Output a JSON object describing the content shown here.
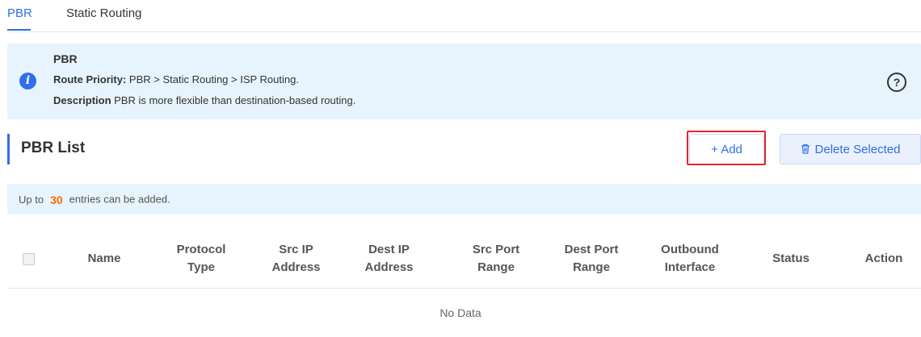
{
  "tabs": [
    {
      "label": "PBR",
      "active": true
    },
    {
      "label": "Static Routing",
      "active": false
    }
  ],
  "info": {
    "icon": "info-icon",
    "title": "PBR",
    "priority_label": "Route Priority:",
    "priority_text": "PBR > Static Routing > ISP Routing.",
    "description_label": "Description",
    "description_text": "PBR is more flexible than destination-based routing.",
    "help_icon": "question-circle-icon"
  },
  "list": {
    "title": "PBR List",
    "add_label": "+ Add",
    "delete_label": "Delete Selected",
    "delete_icon": "trash-icon"
  },
  "note": {
    "prefix": "Up to",
    "count": "30",
    "suffix": "entries can be added."
  },
  "table": {
    "columns": [
      [
        "Name"
      ],
      [
        "Protocol",
        "Type"
      ],
      [
        "Src IP",
        "Address"
      ],
      [
        "Dest IP",
        "Address"
      ],
      [
        "Src Port",
        "Range"
      ],
      [
        "Dest Port",
        "Range"
      ],
      [
        "Outbound",
        "Interface"
      ],
      [
        "Status"
      ],
      [
        "Action"
      ]
    ],
    "empty_text": "No Data"
  },
  "colors": {
    "accent": "#2f6fea",
    "info_bg": "#e8f4fd",
    "highlight": "#e5262b",
    "count": "#ff6a00"
  }
}
